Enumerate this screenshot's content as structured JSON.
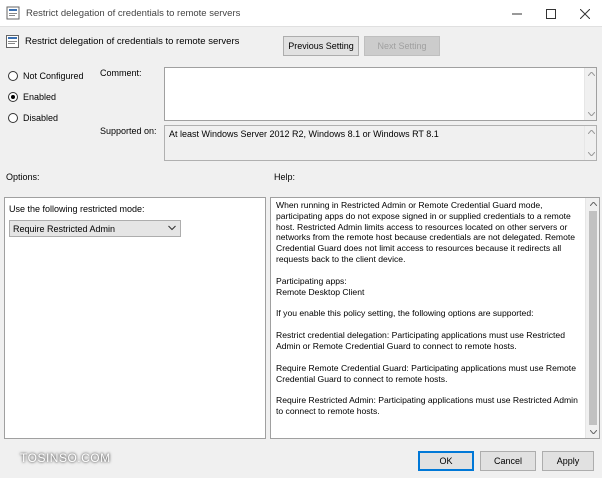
{
  "window": {
    "title": "Restrict delegation of credentials to remote servers"
  },
  "header": {
    "policy_title": "Restrict delegation of credentials to remote servers",
    "previous_label": "Previous Setting",
    "next_label": "Next Setting"
  },
  "state": {
    "options": [
      {
        "label": "Not Configured",
        "checked": false
      },
      {
        "label": "Enabled",
        "checked": true
      },
      {
        "label": "Disabled",
        "checked": false
      }
    ]
  },
  "comment": {
    "label": "Comment:",
    "value": ""
  },
  "supported": {
    "label": "Supported on:",
    "value": "At least Windows Server 2012 R2, Windows 8.1 or Windows RT 8.1"
  },
  "sections": {
    "options_label": "Options:",
    "help_label": "Help:"
  },
  "options_panel": {
    "mode_label": "Use the following restricted mode:",
    "mode_value": "Require Restricted Admin"
  },
  "help": {
    "paragraphs": [
      "When running in Restricted Admin or Remote Credential Guard mode, participating apps do not expose signed in or supplied credentials to a remote host. Restricted Admin limits access to resources located on other servers or networks from the remote host because credentials are not delegated. Remote Credential Guard does not limit access to resources because it redirects all requests back to the client device.",
      "Participating apps:\nRemote Desktop Client",
      "If you enable this policy setting, the following options are supported:",
      "Restrict credential delegation: Participating applications must use Restricted Admin or Remote Credential Guard to connect to remote hosts.",
      "Require Remote Credential Guard: Participating applications must use Remote Credential Guard to connect to remote hosts.",
      "Require Restricted Admin: Participating applications must use Restricted Admin to connect to remote hosts."
    ]
  },
  "footer": {
    "ok_label": "OK",
    "cancel_label": "Cancel",
    "apply_label": "Apply"
  },
  "watermark": "TOSINSO.COM",
  "colors": {
    "accent": "#0078d7",
    "face": "#f0f0f0"
  }
}
